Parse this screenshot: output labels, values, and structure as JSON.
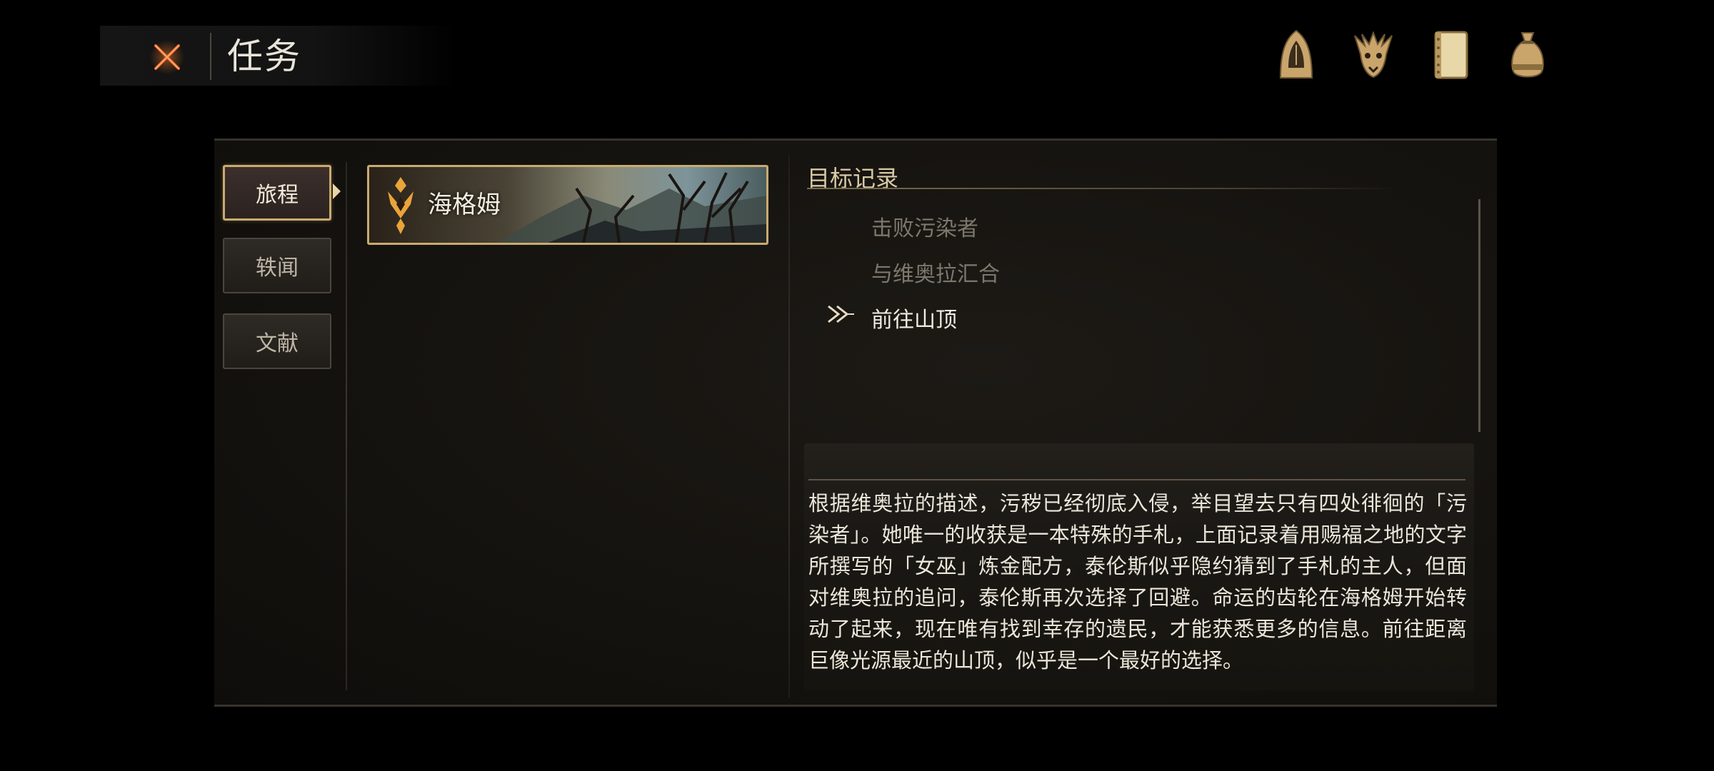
{
  "header": {
    "title": "任务",
    "close_icon": "close-x-icon",
    "icons": [
      "hooded-figure-icon",
      "beast-skull-icon",
      "notebook-icon",
      "pouch-icon"
    ]
  },
  "tabs": [
    {
      "label": "旅程",
      "active": true
    },
    {
      "label": "轶闻",
      "active": false
    },
    {
      "label": "文献",
      "active": false
    }
  ],
  "quest": {
    "name": "海格姆",
    "emblem_icon": "quest-emblem-icon"
  },
  "objectives": {
    "heading": "目标记录",
    "items": [
      {
        "text": "击败污染者",
        "status": "done"
      },
      {
        "text": "与维奥拉汇合",
        "status": "done"
      },
      {
        "text": "前往山顶",
        "status": "current"
      }
    ]
  },
  "description": "根据维奥拉的描述，污秽已经彻底入侵，举目望去只有四处徘徊的「污染者」。她唯一的收获是一本特殊的手札，上面记录着用赐福之地的文字所撰写的「女巫」炼金配方，泰伦斯似乎隐约猜到了手札的主人，但面对维奥拉的追问，泰伦斯再次选择了回避。命运的齿轮在海格姆开始转动了起来，现在唯有找到幸存的遗民，才能获悉更多的信息。前往距离巨像光源最近的山顶，似乎是一个最好的选择。",
  "colors": {
    "accent_gold": "#c9ab6e",
    "close_orange": "#e0652a",
    "background": "#000000",
    "panel": "#15130f"
  }
}
